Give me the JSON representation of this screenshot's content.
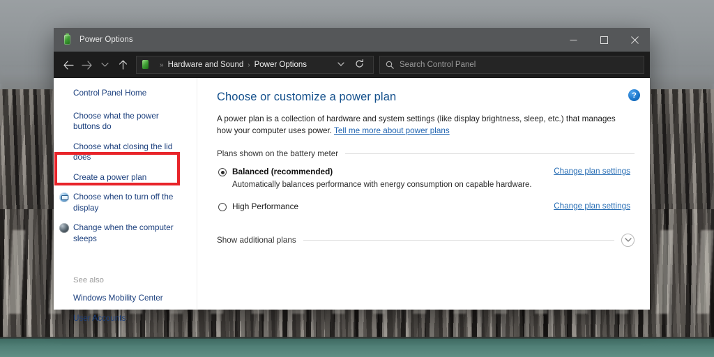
{
  "window": {
    "title": "Power Options",
    "title_icon": "power-battery-icon",
    "controls": {
      "minimize": "–",
      "maximize": "□",
      "close": "✕"
    }
  },
  "addressbar": {
    "back_icon": "arrow-left-icon",
    "forward_icon": "arrow-right-icon",
    "recent_icon": "chevron-down-icon",
    "up_icon": "arrow-up-icon",
    "breadcrumb": {
      "icon": "power-battery-icon",
      "lead_sep": "»",
      "items": [
        "Hardware and Sound",
        "Power Options"
      ],
      "separator": "›"
    },
    "dropdown_icon": "chevron-down-icon",
    "refresh_icon": "refresh-icon"
  },
  "search": {
    "icon": "search-icon",
    "placeholder": "Search Control Panel",
    "value": ""
  },
  "sidebar": {
    "home_link": "Control Panel Home",
    "items": [
      {
        "label": "Choose what the power buttons do",
        "icon": null,
        "highlighted": true
      },
      {
        "label": "Choose what closing the lid does",
        "icon": null,
        "highlighted": false
      },
      {
        "label": "Create a power plan",
        "icon": null,
        "highlighted": false
      },
      {
        "label": "Choose when to turn off the display",
        "icon": "monitor-icon",
        "highlighted": false
      },
      {
        "label": "Change when the computer sleeps",
        "icon": "moon-icon",
        "highlighted": false
      }
    ],
    "see_also_label": "See also",
    "see_also_items": [
      "Windows Mobility Center",
      "User Accounts"
    ]
  },
  "content": {
    "help_icon": "?",
    "title": "Choose or customize a power plan",
    "description_part1": "A power plan is a collection of hardware and system settings (like display brightness, sleep, etc.) that manages how your computer uses power. ",
    "description_link": "Tell me more about power plans",
    "group_label": "Plans shown on the battery meter",
    "plans": [
      {
        "name": "Balanced (recommended)",
        "selected": true,
        "bold": true,
        "description": "Automatically balances performance with energy consumption on capable hardware.",
        "action_link": "Change plan settings"
      },
      {
        "name": "High Performance",
        "selected": false,
        "bold": false,
        "description": "",
        "action_link": "Change plan settings"
      }
    ],
    "show_additional_label": "Show additional plans",
    "show_additional_icon": "chevron-down-icon"
  },
  "annotation": {
    "type": "red-highlight-box",
    "target": "Choose what the power buttons do",
    "color": "#e8242a"
  },
  "colors": {
    "accent_link": "#1b3f7d",
    "title_blue": "#14508c",
    "change_link": "#2a6fb5",
    "titlebar": "#555759",
    "addressbar": "#1c1c1c",
    "annotation_red": "#e8242a"
  }
}
